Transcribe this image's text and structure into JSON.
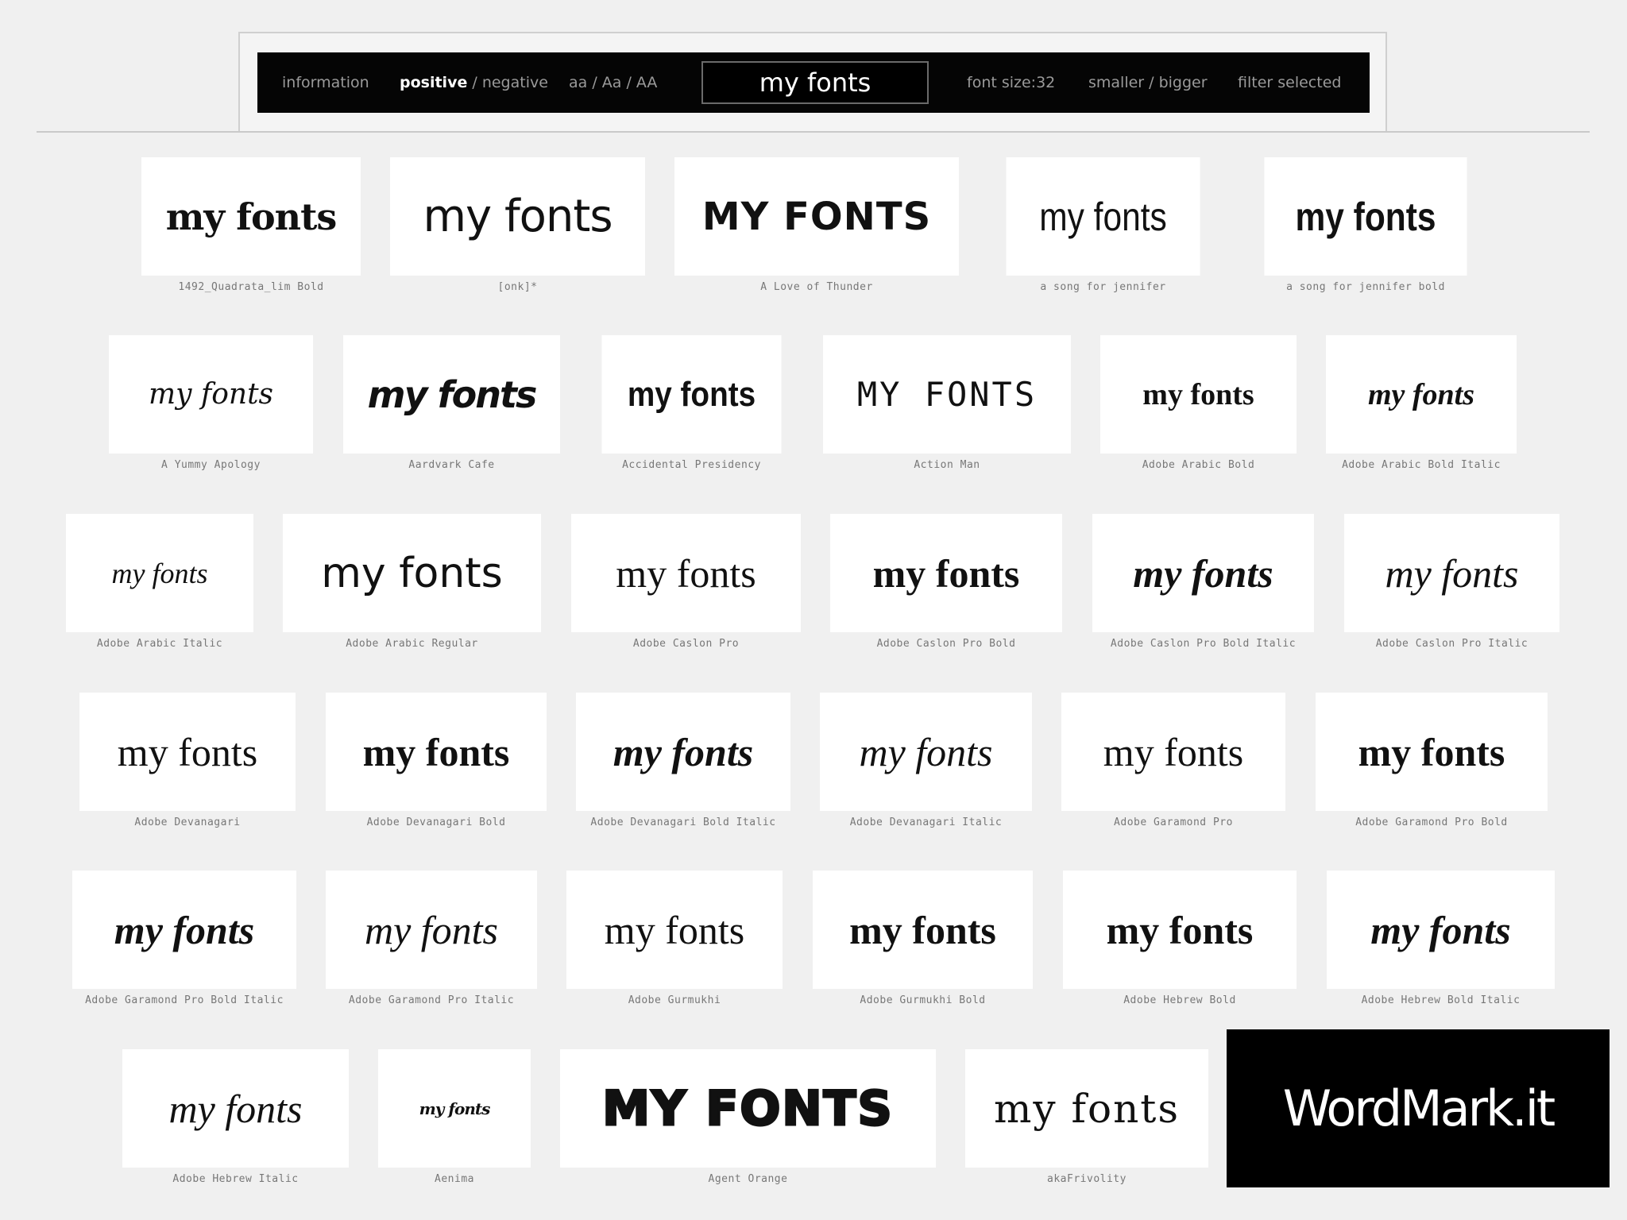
{
  "toolbar": {
    "information": "information",
    "positive": "positive",
    "separator1": " / ",
    "negative": "negative",
    "case_toggle": "aa / Aa / AA",
    "search_value": "my fonts",
    "font_size": "font size:32",
    "smaller": "smaller",
    "separator2": " / ",
    "bigger": "bigger",
    "filter": "filter selected"
  },
  "sample_text": "my fonts",
  "tiles": [
    {
      "sample": "my fonts",
      "font": "1492_Quadrata_lim Bold"
    },
    {
      "sample": "my fonts",
      "font": "[onk]*"
    },
    {
      "sample": "MY FONTS",
      "font": "A Love of Thunder"
    },
    {
      "sample": "my fonts",
      "font": "a song for jennifer"
    },
    {
      "sample": "my fonts",
      "font": "a song for jennifer bold"
    },
    {
      "sample": "my fonts",
      "font": "A Yummy Apology"
    },
    {
      "sample": "my fonts",
      "font": "Aardvark Cafe"
    },
    {
      "sample": "my fonts",
      "font": "Accidental Presidency"
    },
    {
      "sample": "MY FONTS",
      "font": "Action Man"
    },
    {
      "sample": "my fonts",
      "font": "Adobe Arabic Bold"
    },
    {
      "sample": "my fonts",
      "font": "Adobe Arabic Bold Italic"
    },
    {
      "sample": "my fonts",
      "font": "Adobe Arabic Italic"
    },
    {
      "sample": "my fonts",
      "font": "Adobe Arabic Regular"
    },
    {
      "sample": "my fonts",
      "font": "Adobe Caslon Pro"
    },
    {
      "sample": "my fonts",
      "font": "Adobe Caslon Pro Bold"
    },
    {
      "sample": "my fonts",
      "font": "Adobe Caslon Pro Bold Italic"
    },
    {
      "sample": "my fonts",
      "font": "Adobe Caslon Pro Italic"
    },
    {
      "sample": "my fonts",
      "font": "Adobe Devanagari"
    },
    {
      "sample": "my fonts",
      "font": "Adobe Devanagari Bold"
    },
    {
      "sample": "my fonts",
      "font": "Adobe Devanagari Bold Italic"
    },
    {
      "sample": "my fonts",
      "font": "Adobe Devanagari Italic"
    },
    {
      "sample": "my fonts",
      "font": "Adobe Garamond Pro"
    },
    {
      "sample": "my fonts",
      "font": "Adobe Garamond Pro Bold"
    },
    {
      "sample": "my fonts",
      "font": "Adobe Garamond Pro Bold Italic"
    },
    {
      "sample": "my fonts",
      "font": "Adobe Garamond Pro Italic"
    },
    {
      "sample": "my fonts",
      "font": "Adobe Gurmukhi"
    },
    {
      "sample": "my fonts",
      "font": "Adobe Gurmukhi Bold"
    },
    {
      "sample": "my fonts",
      "font": "Adobe Hebrew Bold"
    },
    {
      "sample": "my fonts",
      "font": "Adobe Hebrew Bold Italic"
    },
    {
      "sample": "my fonts",
      "font": "Adobe Hebrew Italic"
    },
    {
      "sample": "my fonts",
      "font": "Aenima"
    },
    {
      "sample": "MY FONTS",
      "font": "Agent Orange"
    },
    {
      "sample": "my fonts",
      "font": "akaFrivolity"
    }
  ],
  "brand": "WordMark.it"
}
